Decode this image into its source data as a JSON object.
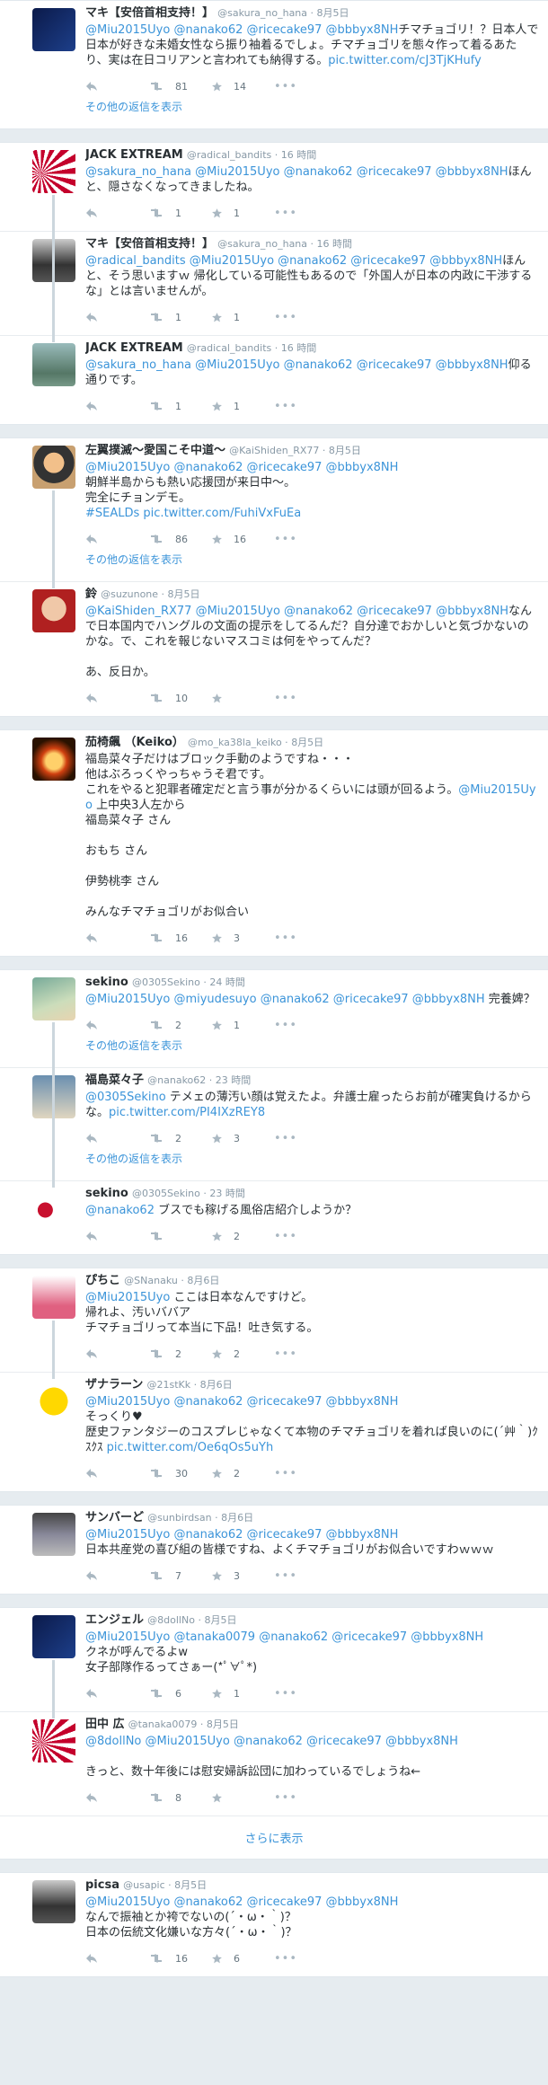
{
  "icons": {
    "reply": "reply-arrow-icon",
    "retweet": "retweet-icon",
    "favorite": "star-icon",
    "more": "more-dots-icon"
  },
  "colors": {
    "link": "#3b94d9",
    "muted": "#8899a6",
    "background": "#e6ecf0",
    "heart": "#e0245e"
  },
  "show_replies_label": "その他の返信を表示",
  "more_dots": "•••",
  "groups": [
    {
      "tweets": [
        {
          "name": "マキ【安倍首相支持！】",
          "handle": "@sakura_no_hana",
          "time": "8月5日",
          "mentions": "@Miu2015Uyo @nanako62 @ricecake97 @bbbyx8NH",
          "body": "チマチョゴリ！？日本人で日本が好きな未婚女性なら振り袖着るでしょ。チマチョゴリを態々作って着るあたり、実は在日コリアンと言われても納得する。",
          "link": "pic.twitter.com/cJ3TjKHufy",
          "retweets": "81",
          "favorites": "14"
        }
      ],
      "show_replies": true
    },
    {
      "tweets": [
        {
          "name": "JACK EXTREAM",
          "handle": "@radical_bandits",
          "time": "16 時間",
          "mentions": "@sakura_no_hana @Miu2015Uyo @nanako62 @ricecake97 @bbbyx8NH",
          "body": "ほんと、隠さなくなってきましたね。",
          "retweets": "1",
          "favorites": "1"
        },
        {
          "name": "マキ【安倍首相支持！】",
          "handle": "@sakura_no_hana",
          "time": "16 時間",
          "mentions": "@radical_bandits @Miu2015Uyo @nanako62 @ricecake97 @bbbyx8NH",
          "body": "ほんと、そう思いますｗ 帰化している可能性もあるので「外国人が日本の内政に干渉するな」とは言いませんが。",
          "retweets": "1",
          "favorites": "1"
        },
        {
          "name": "JACK EXTREAM",
          "handle": "@radical_bandits",
          "time": "16 時間",
          "mentions": "@sakura_no_hana @Miu2015Uyo @nanako62 @ricecake97 @bbbyx8NH",
          "body": "仰る通りです。",
          "retweets": "1",
          "favorites": "1"
        }
      ]
    },
    {
      "tweets": [
        {
          "name": "左翼撲滅〜愛国こそ中道〜",
          "handle": "@KaiShiden_RX77",
          "time": "8月5日",
          "mentions": "@Miu2015Uyo @nanako62 @ricecake97 @bbbyx8NH",
          "body": "\n朝鮮半島からも熱い応援団が来日中〜。\n完全にチョンデモ。\n",
          "hashtag": "#SEALDs",
          "link": "pic.twitter.com/FuhiVxFuEa",
          "retweets": "86",
          "favorites": "16"
        }
      ],
      "show_replies": true,
      "extra": [
        {
          "name": "鈴",
          "handle": "@suzunone",
          "time": "8月5日",
          "mentions": "@KaiShiden_RX77 @Miu2015Uyo @nanako62 @ricecake97 @bbbyx8NH",
          "body": "なんで日本国内でハングルの文面の提示をしてるんだ？自分達でおかしいと気づかないのかな。で、これを報じないマスコミは何をやってんだ？\n\nあ、反日か。",
          "retweets": "10",
          "favorites": ""
        }
      ]
    },
    {
      "tweets": [
        {
          "name": "茄椅飆 （Keiko）",
          "handle": "@mo_ka38la_keiko",
          "time": "8月5日",
          "mentions": "",
          "body": "福島菜々子だけはブロック手動のようですね・・・\n他はぶろっくやっちゃうそ君です。\nこれをやると犯罪者確定だと言う事が分かるくらいには頭が回るよう。",
          "body_mention": "@Miu2015Uyo",
          "body_tail": " 上中央3人左から\n福島菜々子 さん\n\nおもち さん\n\n伊勢桃李 さん\n\nみんなチマチョゴリがお似合い",
          "retweets": "16",
          "favorites": "3"
        }
      ]
    },
    {
      "tweets": [
        {
          "name": "sekino",
          "handle": "@0305Sekino",
          "time": "24 時間",
          "mentions": "@Miu2015Uyo @miyudesuyo @nanako62 @ricecake97 @bbbyx8NH",
          "body": " 完養婢？",
          "retweets": "2",
          "favorites": "1"
        }
      ],
      "show_replies": true,
      "extra": [
        {
          "name": "福島菜々子",
          "handle": "@nanako62",
          "time": "23 時間",
          "mentions": "@0305Sekino",
          "body": " テメェの薄汚い顔は覚えたよ。弁護士雇ったらお前が確実負けるからな。",
          "link": "pic.twitter.com/PI4IXzREY8",
          "retweets": "2",
          "favorites": "3",
          "show_replies": true
        },
        {
          "name": "sekino",
          "handle": "@0305Sekino",
          "time": "23 時間",
          "mentions": "@nanako62",
          "body": " ブスでも稼げる風俗店紹介しようか？",
          "retweets": "",
          "favorites": "2"
        }
      ]
    },
    {
      "tweets": [
        {
          "name": "ぴちこ",
          "handle": "@SNanaku",
          "time": "8月6日",
          "mentions": "@Miu2015Uyo",
          "body": " ここは日本なんですけど。\n帰れよ、汚いババア\nチマチョゴリって本当に下品！吐き気する。",
          "retweets": "2",
          "favorites": "2"
        },
        {
          "name": "ザナラーン",
          "handle": "@21stKk",
          "time": "8月6日",
          "mentions": "@Miu2015Uyo @nanako62 @ricecake97 @bbbyx8NH",
          "body": "\nそっくり♥\n歴史ファンタジーのコスプレじゃなくて本物のチマチョゴリを着れば良いのに(´艸｀)ｸｽｸｽ ",
          "link": "pic.twitter.com/Oe6qOs5uYh",
          "retweets": "30",
          "favorites": "2"
        }
      ]
    },
    {
      "tweets": [
        {
          "name": "サンバーど",
          "handle": "@sunbirdsan",
          "time": "8月6日",
          "mentions": "@Miu2015Uyo @nanako62 @ricecake97 @bbbyx8NH",
          "body": "\n日本共産党の喜び組の皆様ですね、よくチマチョゴリがお似合いですわｗｗｗ",
          "retweets": "7",
          "favorites": "3"
        }
      ]
    },
    {
      "tweets": [
        {
          "name": "エンジェル",
          "handle": "@8dollNo",
          "time": "8月5日",
          "mentions": "@Miu2015Uyo @tanaka0079 @nanako62 @ricecake97 @bbbyx8NH",
          "body": "\nクネが呼んでるよw\n女子部隊作るってさぁー(*ﾟ∀ﾟ*)",
          "retweets": "6",
          "favorites": "1"
        },
        {
          "name": "田中 広",
          "handle": "@tanaka0079",
          "time": "8月5日",
          "mentions": "@8dollNo @Miu2015Uyo @nanako62 @ricecake97 @bbbyx8NH",
          "body": "\n\nきっと、数十年後には慰安婦訴訟団に加わっているでしょうね←",
          "retweets": "8",
          "favorites": ""
        }
      ],
      "load_more": "さらに表示"
    },
    {
      "tweets": [
        {
          "name": "picsa",
          "handle": "@usapic",
          "time": "8月5日",
          "mentions": "@Miu2015Uyo @nanako62 @ricecake97 @bbbyx8NH",
          "body": "\nなんで振袖とか袴でないの(´・ω・｀)？\n日本の伝統文化嫌いな方々(´・ω・｀)？",
          "retweets": "16",
          "favorites": "6"
        }
      ]
    }
  ]
}
